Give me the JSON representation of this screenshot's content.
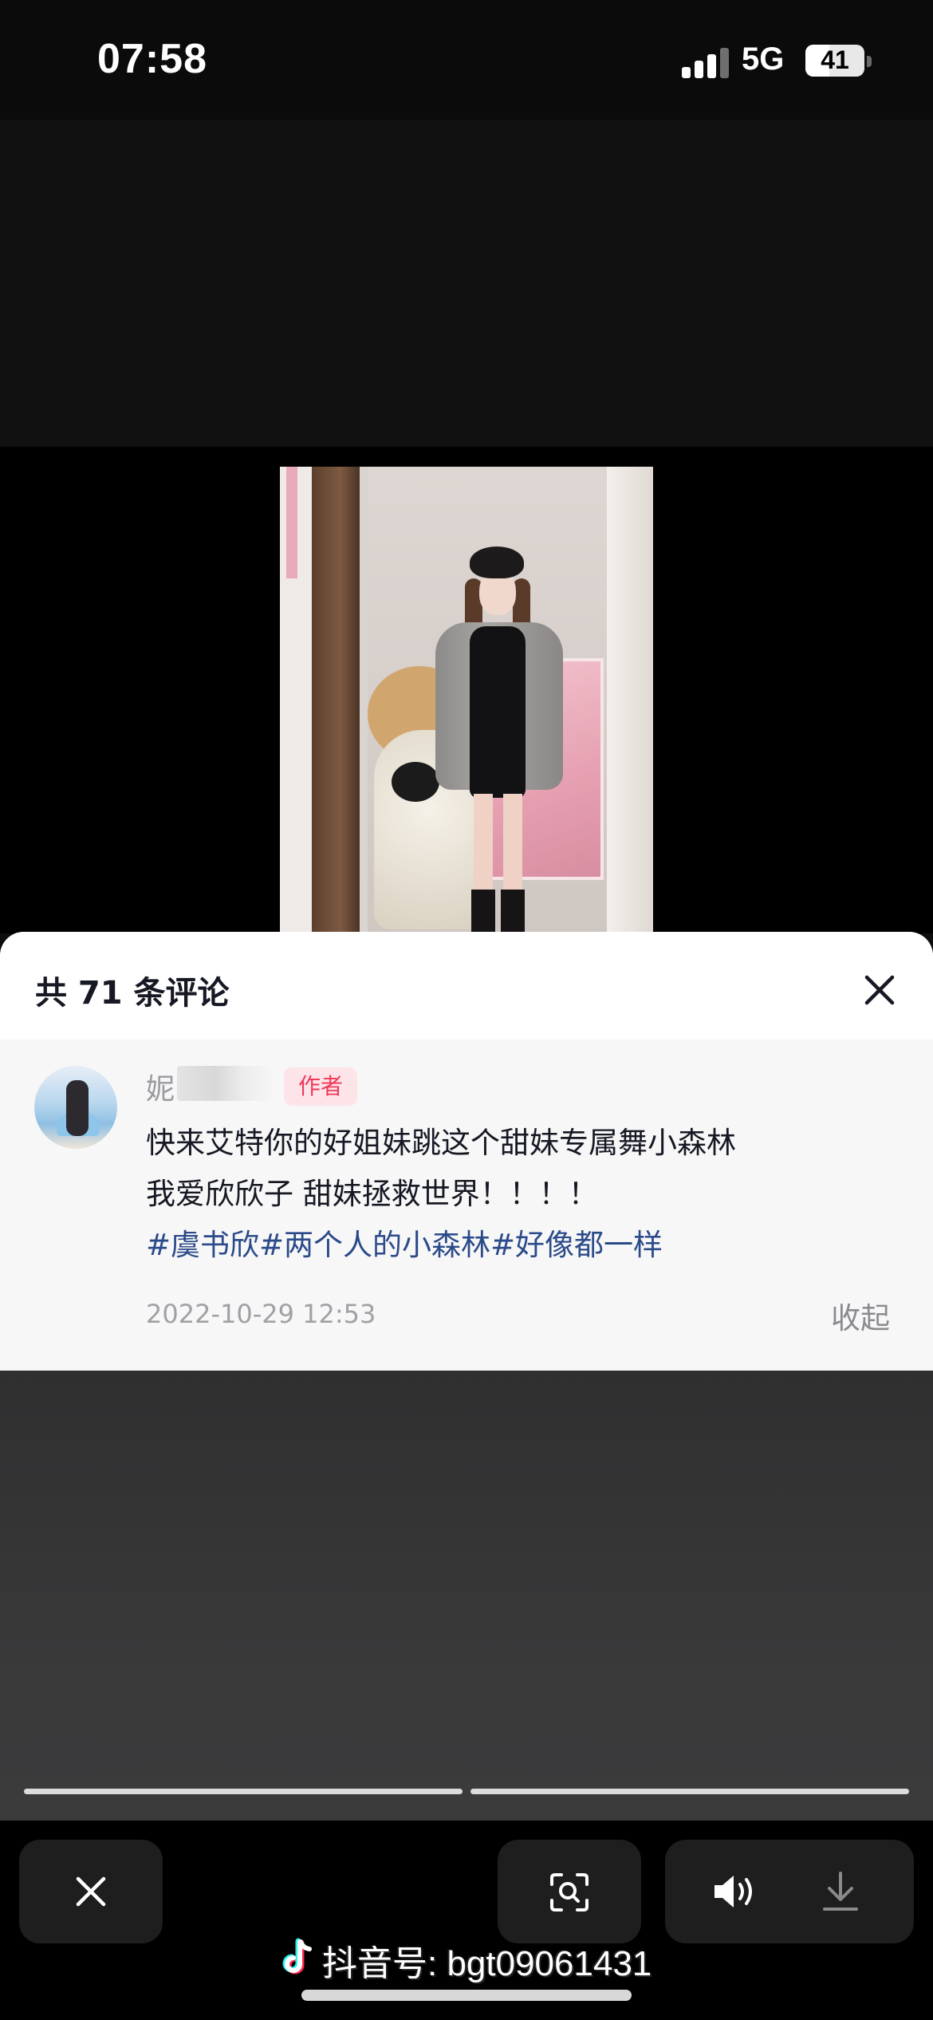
{
  "status_bar": {
    "time": "07:58",
    "network": "5G",
    "battery": "41",
    "battery_level": 0.41
  },
  "comments_panel": {
    "title": "共 71 条评论",
    "comment": {
      "username_visible": "妮",
      "author_badge": "作者",
      "text_line_1": "快来艾特你的好姐妹跳这个甜妹专属舞小森林",
      "text_line_2": "我爱欣欣子 甜妹拯救世界！！！！",
      "hashtags": "#虞书欣#两个人的小森林#好像都一样",
      "timestamp": "2022-10-29 12:53",
      "collapse_label": "收起"
    }
  },
  "watermark": {
    "text": "抖音号: bgt09061431"
  },
  "icons": {
    "close_sheet": "close-icon",
    "close_viewer": "close-icon",
    "scan": "scan-icon",
    "sound": "speaker-icon",
    "download": "download-icon",
    "logo": "tiktok-logo-icon"
  }
}
